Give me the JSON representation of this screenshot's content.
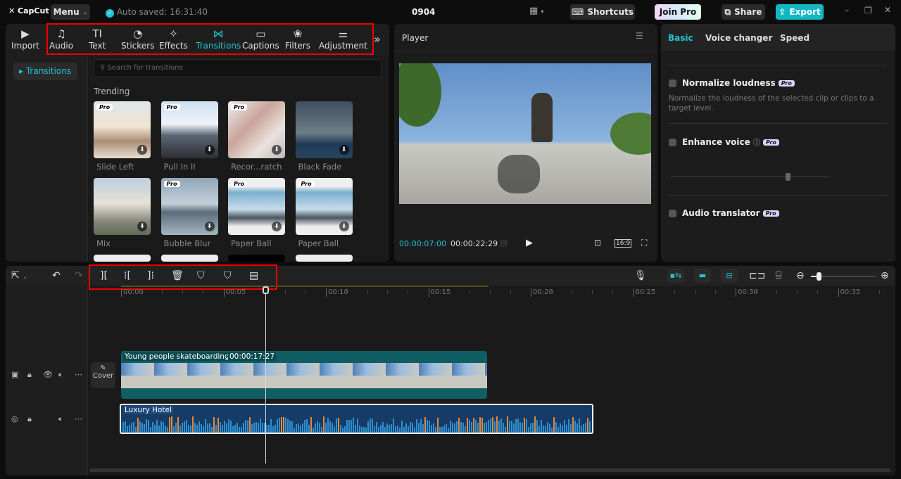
{
  "app": {
    "logo": "CapCut",
    "menu": "Menu",
    "autosave": "Auto saved: 16:31:40",
    "project": "0904",
    "shortcuts": "Shortcuts",
    "join_pro": "Join Pro",
    "share": "Share",
    "export": "Export"
  },
  "tabs": [
    {
      "label": "Import",
      "icon": "▶"
    },
    {
      "label": "Audio",
      "icon": "♫"
    },
    {
      "label": "Text",
      "icon": "TI"
    },
    {
      "label": "Stickers",
      "icon": "◔"
    },
    {
      "label": "Effects",
      "icon": "✧"
    },
    {
      "label": "Transitions",
      "icon": "⋈"
    },
    {
      "label": "Captions",
      "icon": "▭"
    },
    {
      "label": "Filters",
      "icon": "❀"
    },
    {
      "label": "Adjustment",
      "icon": "⚌"
    }
  ],
  "sidebar": {
    "active": "Transitions"
  },
  "search": {
    "placeholder": "Search for transitions"
  },
  "section": "Trending",
  "transitions": [
    {
      "label": "Slide Left",
      "pro": "Pro",
      "bg": "linear-gradient(#dfe6ea,#f1e4d2 45%,#a98d76 70%,#e9ddd0)"
    },
    {
      "label": "Pull In II",
      "pro": "Pro",
      "bg": "linear-gradient(#cfe0f0,#eef3f7 40%,#5b6572 60%,#2d2f36)"
    },
    {
      "label": "Recor...ratch",
      "pro": "Pro",
      "bg": "linear-gradient(135deg,#eee,#c9a49a 40%,#eae1dc 70%,#bbb)"
    },
    {
      "label": "Black Fade",
      "pro": "",
      "bg": "linear-gradient(#3f4e5c,#6d7d88 55%,#1f3a55 75%,#28445e)"
    },
    {
      "label": "Mix",
      "pro": "",
      "bg": "linear-gradient(#bcd0e0,#e7e2d8 45%,#8b8a7f 75%,#5e6a55)"
    },
    {
      "label": "Bubble Blur",
      "pro": "Pro",
      "bg": "linear-gradient(#8fa6b7,#c4d0d9 45%,#5d6d7c 60%,#a5b5bf)"
    },
    {
      "label": "Paper Ball",
      "pro": "Pro",
      "bg": "linear-gradient(#eee 15%,#7ab0cf 25%,#c8dbe8 55%,#4a5560 70%,#eee 85%)"
    },
    {
      "label": "Paper Ball",
      "pro": "Pro",
      "bg": "linear-gradient(#eee 15%,#7ab0cf 25%,#c8dbe8 55%,#4a5560 70%,#eee 85%)"
    }
  ],
  "player": {
    "title": "Player",
    "current": "00:00:07:00",
    "total": "00:00:22:29",
    "ratio": "16:9"
  },
  "right": {
    "tabs": [
      "Basic",
      "Voice changer",
      "Speed"
    ],
    "normalize": {
      "label": "Normalize loudness",
      "pro": "Pro",
      "desc": "Normalize the loudness of the selected clip or clips to a target level."
    },
    "enhance": {
      "label": "Enhance voice",
      "pro": "Pro"
    },
    "translator": {
      "label": "Audio translator",
      "pro": "Pro"
    }
  },
  "timeline": {
    "ticks": [
      "00:00",
      "00:05",
      "00:10",
      "00:15",
      "00:20",
      "00:25",
      "00:30",
      "00:35"
    ],
    "playhead_seconds": 7,
    "video_clip": {
      "name": "Young people skateboarding",
      "duration": "00:00:17:27"
    },
    "audio_clip": {
      "name": "Luxury Hotel"
    },
    "cover": "Cover"
  },
  "colors": {
    "accent": "#22c4d0",
    "export": "#13b7c4",
    "video_track": "#0e5e63",
    "audio_track": "#163b66"
  }
}
